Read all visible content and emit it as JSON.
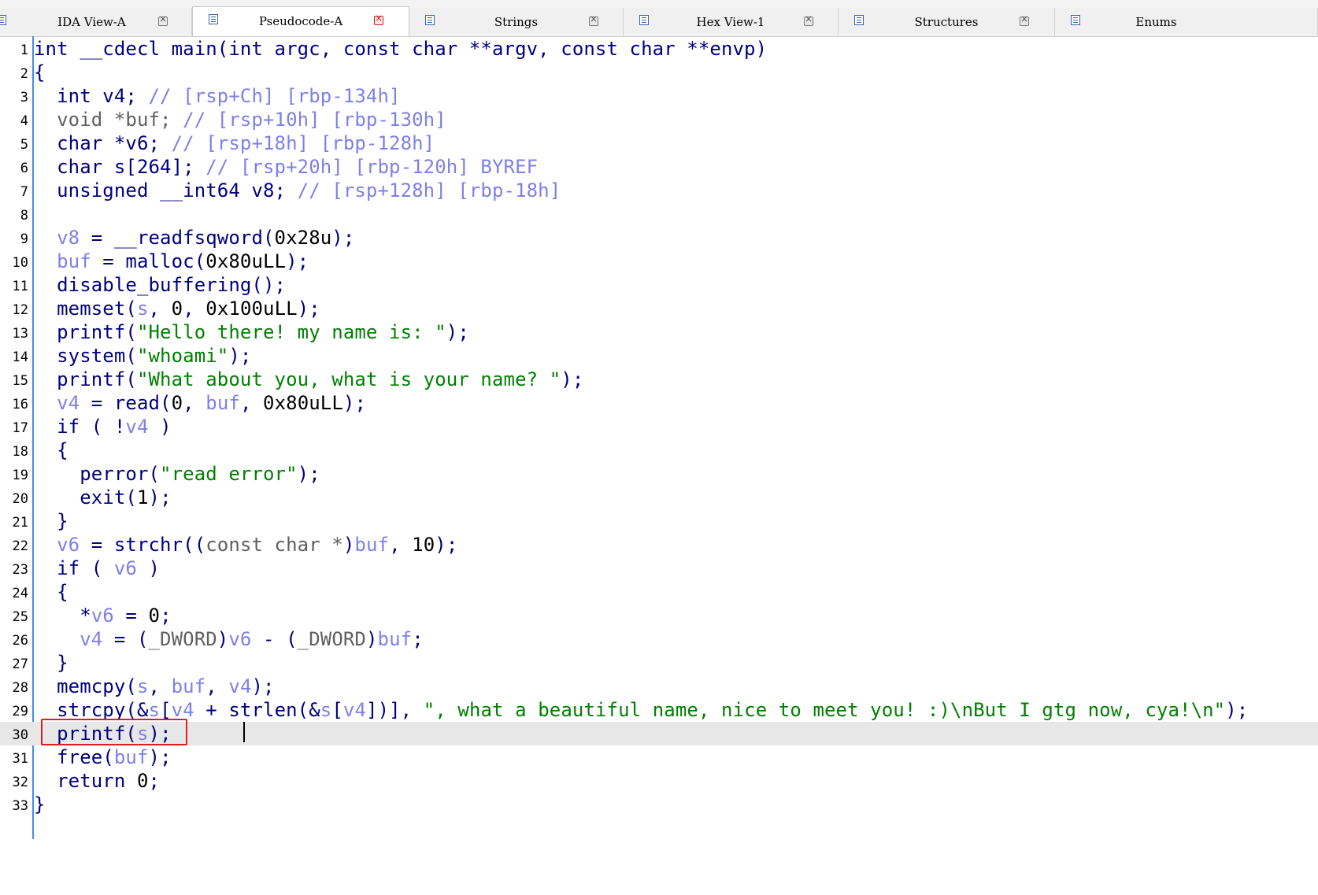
{
  "tabs": [
    {
      "label": "IDA View-A",
      "active": false
    },
    {
      "label": "Pseudocode-A",
      "active": true
    },
    {
      "label": "Strings",
      "active": false
    },
    {
      "label": "Hex View-1",
      "active": false
    },
    {
      "label": "Structures",
      "active": false
    },
    {
      "label": "Enums",
      "active": false
    }
  ],
  "code": {
    "current_line": 30,
    "lines": [
      {
        "n": "1",
        "tokens": [
          [
            "kw",
            "int __cdecl main(int argc, const char **argv, const char **envp)"
          ]
        ]
      },
      {
        "n": "2",
        "tokens": [
          [
            "kw",
            "{"
          ]
        ]
      },
      {
        "n": "3",
        "tokens": [
          [
            "kw",
            "  int v4; "
          ],
          [
            "cmt",
            "// [rsp+Ch] [rbp-134h]"
          ]
        ]
      },
      {
        "n": "4",
        "tokens": [
          [
            "gray",
            "  void *buf; "
          ],
          [
            "cmt",
            "// [rsp+10h] [rbp-130h]"
          ]
        ]
      },
      {
        "n": "5",
        "tokens": [
          [
            "kw",
            "  char *v6; "
          ],
          [
            "cmt",
            "// [rsp+18h] [rbp-128h]"
          ]
        ]
      },
      {
        "n": "6",
        "tokens": [
          [
            "kw",
            "  char s[264]; "
          ],
          [
            "cmt",
            "// [rsp+20h] [rbp-120h] BYREF"
          ]
        ]
      },
      {
        "n": "7",
        "tokens": [
          [
            "kw",
            "  unsigned __int64 v8; "
          ],
          [
            "cmt",
            "// [rsp+128h] [rbp-18h]"
          ]
        ]
      },
      {
        "n": "8",
        "tokens": [
          [
            "kw",
            ""
          ]
        ]
      },
      {
        "n": "9",
        "tokens": [
          [
            "var",
            "  v8"
          ],
          [
            "kw",
            " = __readfsqword("
          ],
          [
            "blk",
            "0x28u"
          ],
          [
            "kw",
            ");"
          ]
        ]
      },
      {
        "n": "10",
        "tokens": [
          [
            "var",
            "  buf"
          ],
          [
            "kw",
            " = malloc("
          ],
          [
            "blk",
            "0x80uLL"
          ],
          [
            "kw",
            ");"
          ]
        ]
      },
      {
        "n": "11",
        "tokens": [
          [
            "kw",
            "  disable_buffering();"
          ]
        ]
      },
      {
        "n": "12",
        "tokens": [
          [
            "kw",
            "  memset("
          ],
          [
            "var",
            "s"
          ],
          [
            "kw",
            ", "
          ],
          [
            "blk",
            "0"
          ],
          [
            "kw",
            ", "
          ],
          [
            "blk",
            "0x100uLL"
          ],
          [
            "kw",
            ");"
          ]
        ]
      },
      {
        "n": "13",
        "tokens": [
          [
            "kw",
            "  printf("
          ],
          [
            "str",
            "\"Hello there! my name is: \""
          ],
          [
            "kw",
            ");"
          ]
        ]
      },
      {
        "n": "14",
        "tokens": [
          [
            "kw",
            "  system("
          ],
          [
            "str",
            "\"whoami\""
          ],
          [
            "kw",
            ");"
          ]
        ]
      },
      {
        "n": "15",
        "tokens": [
          [
            "kw",
            "  printf("
          ],
          [
            "str",
            "\"What about you, what is your name? \""
          ],
          [
            "kw",
            ");"
          ]
        ]
      },
      {
        "n": "16",
        "tokens": [
          [
            "var",
            "  v4"
          ],
          [
            "kw",
            " = read("
          ],
          [
            "blk",
            "0"
          ],
          [
            "kw",
            ", "
          ],
          [
            "var",
            "buf"
          ],
          [
            "kw",
            ", "
          ],
          [
            "blk",
            "0x80uLL"
          ],
          [
            "kw",
            ");"
          ]
        ]
      },
      {
        "n": "17",
        "tokens": [
          [
            "kw",
            "  if ( !"
          ],
          [
            "var",
            "v4"
          ],
          [
            "kw",
            " )"
          ]
        ]
      },
      {
        "n": "18",
        "tokens": [
          [
            "kw",
            "  {"
          ]
        ]
      },
      {
        "n": "19",
        "tokens": [
          [
            "kw",
            "    perror("
          ],
          [
            "str",
            "\"read error\""
          ],
          [
            "kw",
            ");"
          ]
        ]
      },
      {
        "n": "20",
        "tokens": [
          [
            "kw",
            "    exit("
          ],
          [
            "blk",
            "1"
          ],
          [
            "kw",
            ");"
          ]
        ]
      },
      {
        "n": "21",
        "tokens": [
          [
            "kw",
            "  }"
          ]
        ]
      },
      {
        "n": "22",
        "tokens": [
          [
            "var",
            "  v6"
          ],
          [
            "kw",
            " = strchr(("
          ],
          [
            "gray",
            "const char *"
          ],
          [
            "kw",
            ")"
          ],
          [
            "var",
            "buf"
          ],
          [
            "kw",
            ", "
          ],
          [
            "blk",
            "10"
          ],
          [
            "kw",
            ");"
          ]
        ]
      },
      {
        "n": "23",
        "tokens": [
          [
            "kw",
            "  if ( "
          ],
          [
            "var",
            "v6"
          ],
          [
            "kw",
            " )"
          ]
        ]
      },
      {
        "n": "24",
        "tokens": [
          [
            "kw",
            "  {"
          ]
        ]
      },
      {
        "n": "25",
        "tokens": [
          [
            "kw",
            "    *"
          ],
          [
            "var",
            "v6"
          ],
          [
            "kw",
            " = "
          ],
          [
            "blk",
            "0"
          ],
          [
            "kw",
            ";"
          ]
        ]
      },
      {
        "n": "26",
        "tokens": [
          [
            "var",
            "    v4"
          ],
          [
            "kw",
            " = ("
          ],
          [
            "gray",
            "_DWORD"
          ],
          [
            "kw",
            ")"
          ],
          [
            "var",
            "v6"
          ],
          [
            "kw",
            " - ("
          ],
          [
            "gray",
            "_DWORD"
          ],
          [
            "kw",
            ")"
          ],
          [
            "var",
            "buf"
          ],
          [
            "kw",
            ";"
          ]
        ]
      },
      {
        "n": "27",
        "tokens": [
          [
            "kw",
            "  }"
          ]
        ]
      },
      {
        "n": "28",
        "tokens": [
          [
            "kw",
            "  memcpy("
          ],
          [
            "var",
            "s"
          ],
          [
            "kw",
            ", "
          ],
          [
            "var",
            "buf"
          ],
          [
            "kw",
            ", "
          ],
          [
            "var",
            "v4"
          ],
          [
            "kw",
            ");"
          ]
        ]
      },
      {
        "n": "29",
        "tokens": [
          [
            "kw",
            "  strcpy(&"
          ],
          [
            "var",
            "s"
          ],
          [
            "kw",
            "["
          ],
          [
            "var",
            "v4"
          ],
          [
            "kw",
            " + strlen(&"
          ],
          [
            "var",
            "s"
          ],
          [
            "kw",
            "["
          ],
          [
            "var",
            "v4"
          ],
          [
            "kw",
            "])], "
          ],
          [
            "str",
            "\", what a beautiful name, nice to meet you! :)\\nBut I gtg now, cya!\\n\""
          ],
          [
            "kw",
            ");"
          ]
        ]
      },
      {
        "n": "30",
        "tokens": [
          [
            "kw",
            "  printf("
          ],
          [
            "var",
            "s"
          ],
          [
            "kw",
            ");"
          ]
        ]
      },
      {
        "n": "31",
        "tokens": [
          [
            "kw",
            "  free("
          ],
          [
            "var",
            "buf"
          ],
          [
            "kw",
            ");"
          ]
        ]
      },
      {
        "n": "32",
        "tokens": [
          [
            "kw",
            "  return "
          ],
          [
            "blk",
            "0"
          ],
          [
            "kw",
            ";"
          ]
        ]
      },
      {
        "n": "33",
        "tokens": [
          [
            "kw",
            "}"
          ]
        ]
      }
    ]
  }
}
